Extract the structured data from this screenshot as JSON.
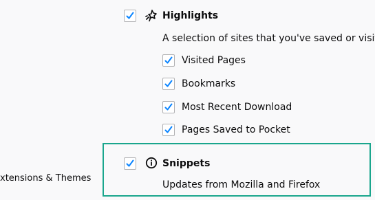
{
  "sidebar": {
    "extensions_themes_label": "xtensions & Themes"
  },
  "highlights": {
    "label": "Highlights",
    "checked": true,
    "icon": "highlights-icon",
    "description": "A selection of sites that you've saved or visited",
    "options": [
      {
        "label": "Visited Pages",
        "checked": true
      },
      {
        "label": "Bookmarks",
        "checked": true
      },
      {
        "label": "Most Recent Download",
        "checked": true
      },
      {
        "label": "Pages Saved to Pocket",
        "checked": true
      }
    ]
  },
  "snippets": {
    "label": "Snippets",
    "checked": true,
    "icon": "info-icon",
    "description": "Updates from Mozilla and Firefox"
  },
  "colors": {
    "check": "#0a84ff",
    "highlight_border": "#1aa68d",
    "background": "#f9f9fa"
  }
}
